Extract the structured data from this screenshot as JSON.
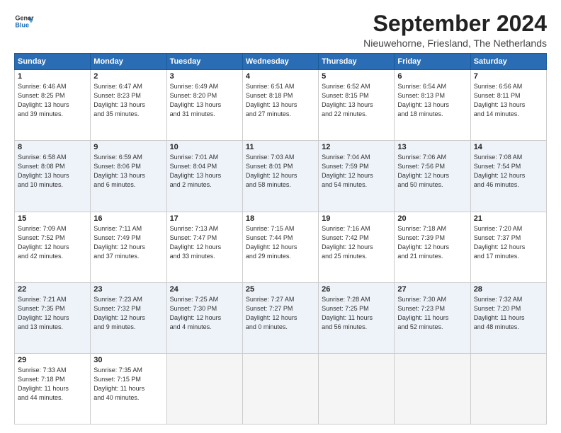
{
  "logo": {
    "line1": "General",
    "line2": "Blue"
  },
  "title": "September 2024",
  "location": "Nieuwehorne, Friesland, The Netherlands",
  "header_days": [
    "Sunday",
    "Monday",
    "Tuesday",
    "Wednesday",
    "Thursday",
    "Friday",
    "Saturday"
  ],
  "weeks": [
    [
      {
        "day": "1",
        "info": "Sunrise: 6:46 AM\nSunset: 8:25 PM\nDaylight: 13 hours\nand 39 minutes."
      },
      {
        "day": "2",
        "info": "Sunrise: 6:47 AM\nSunset: 8:23 PM\nDaylight: 13 hours\nand 35 minutes."
      },
      {
        "day": "3",
        "info": "Sunrise: 6:49 AM\nSunset: 8:20 PM\nDaylight: 13 hours\nand 31 minutes."
      },
      {
        "day": "4",
        "info": "Sunrise: 6:51 AM\nSunset: 8:18 PM\nDaylight: 13 hours\nand 27 minutes."
      },
      {
        "day": "5",
        "info": "Sunrise: 6:52 AM\nSunset: 8:15 PM\nDaylight: 13 hours\nand 22 minutes."
      },
      {
        "day": "6",
        "info": "Sunrise: 6:54 AM\nSunset: 8:13 PM\nDaylight: 13 hours\nand 18 minutes."
      },
      {
        "day": "7",
        "info": "Sunrise: 6:56 AM\nSunset: 8:11 PM\nDaylight: 13 hours\nand 14 minutes."
      }
    ],
    [
      {
        "day": "8",
        "info": "Sunrise: 6:58 AM\nSunset: 8:08 PM\nDaylight: 13 hours\nand 10 minutes."
      },
      {
        "day": "9",
        "info": "Sunrise: 6:59 AM\nSunset: 8:06 PM\nDaylight: 13 hours\nand 6 minutes."
      },
      {
        "day": "10",
        "info": "Sunrise: 7:01 AM\nSunset: 8:04 PM\nDaylight: 13 hours\nand 2 minutes."
      },
      {
        "day": "11",
        "info": "Sunrise: 7:03 AM\nSunset: 8:01 PM\nDaylight: 12 hours\nand 58 minutes."
      },
      {
        "day": "12",
        "info": "Sunrise: 7:04 AM\nSunset: 7:59 PM\nDaylight: 12 hours\nand 54 minutes."
      },
      {
        "day": "13",
        "info": "Sunrise: 7:06 AM\nSunset: 7:56 PM\nDaylight: 12 hours\nand 50 minutes."
      },
      {
        "day": "14",
        "info": "Sunrise: 7:08 AM\nSunset: 7:54 PM\nDaylight: 12 hours\nand 46 minutes."
      }
    ],
    [
      {
        "day": "15",
        "info": "Sunrise: 7:09 AM\nSunset: 7:52 PM\nDaylight: 12 hours\nand 42 minutes."
      },
      {
        "day": "16",
        "info": "Sunrise: 7:11 AM\nSunset: 7:49 PM\nDaylight: 12 hours\nand 37 minutes."
      },
      {
        "day": "17",
        "info": "Sunrise: 7:13 AM\nSunset: 7:47 PM\nDaylight: 12 hours\nand 33 minutes."
      },
      {
        "day": "18",
        "info": "Sunrise: 7:15 AM\nSunset: 7:44 PM\nDaylight: 12 hours\nand 29 minutes."
      },
      {
        "day": "19",
        "info": "Sunrise: 7:16 AM\nSunset: 7:42 PM\nDaylight: 12 hours\nand 25 minutes."
      },
      {
        "day": "20",
        "info": "Sunrise: 7:18 AM\nSunset: 7:39 PM\nDaylight: 12 hours\nand 21 minutes."
      },
      {
        "day": "21",
        "info": "Sunrise: 7:20 AM\nSunset: 7:37 PM\nDaylight: 12 hours\nand 17 minutes."
      }
    ],
    [
      {
        "day": "22",
        "info": "Sunrise: 7:21 AM\nSunset: 7:35 PM\nDaylight: 12 hours\nand 13 minutes."
      },
      {
        "day": "23",
        "info": "Sunrise: 7:23 AM\nSunset: 7:32 PM\nDaylight: 12 hours\nand 9 minutes."
      },
      {
        "day": "24",
        "info": "Sunrise: 7:25 AM\nSunset: 7:30 PM\nDaylight: 12 hours\nand 4 minutes."
      },
      {
        "day": "25",
        "info": "Sunrise: 7:27 AM\nSunset: 7:27 PM\nDaylight: 12 hours\nand 0 minutes."
      },
      {
        "day": "26",
        "info": "Sunrise: 7:28 AM\nSunset: 7:25 PM\nDaylight: 11 hours\nand 56 minutes."
      },
      {
        "day": "27",
        "info": "Sunrise: 7:30 AM\nSunset: 7:23 PM\nDaylight: 11 hours\nand 52 minutes."
      },
      {
        "day": "28",
        "info": "Sunrise: 7:32 AM\nSunset: 7:20 PM\nDaylight: 11 hours\nand 48 minutes."
      }
    ],
    [
      {
        "day": "29",
        "info": "Sunrise: 7:33 AM\nSunset: 7:18 PM\nDaylight: 11 hours\nand 44 minutes."
      },
      {
        "day": "30",
        "info": "Sunrise: 7:35 AM\nSunset: 7:15 PM\nDaylight: 11 hours\nand 40 minutes."
      },
      {
        "day": "",
        "info": ""
      },
      {
        "day": "",
        "info": ""
      },
      {
        "day": "",
        "info": ""
      },
      {
        "day": "",
        "info": ""
      },
      {
        "day": "",
        "info": ""
      }
    ]
  ]
}
